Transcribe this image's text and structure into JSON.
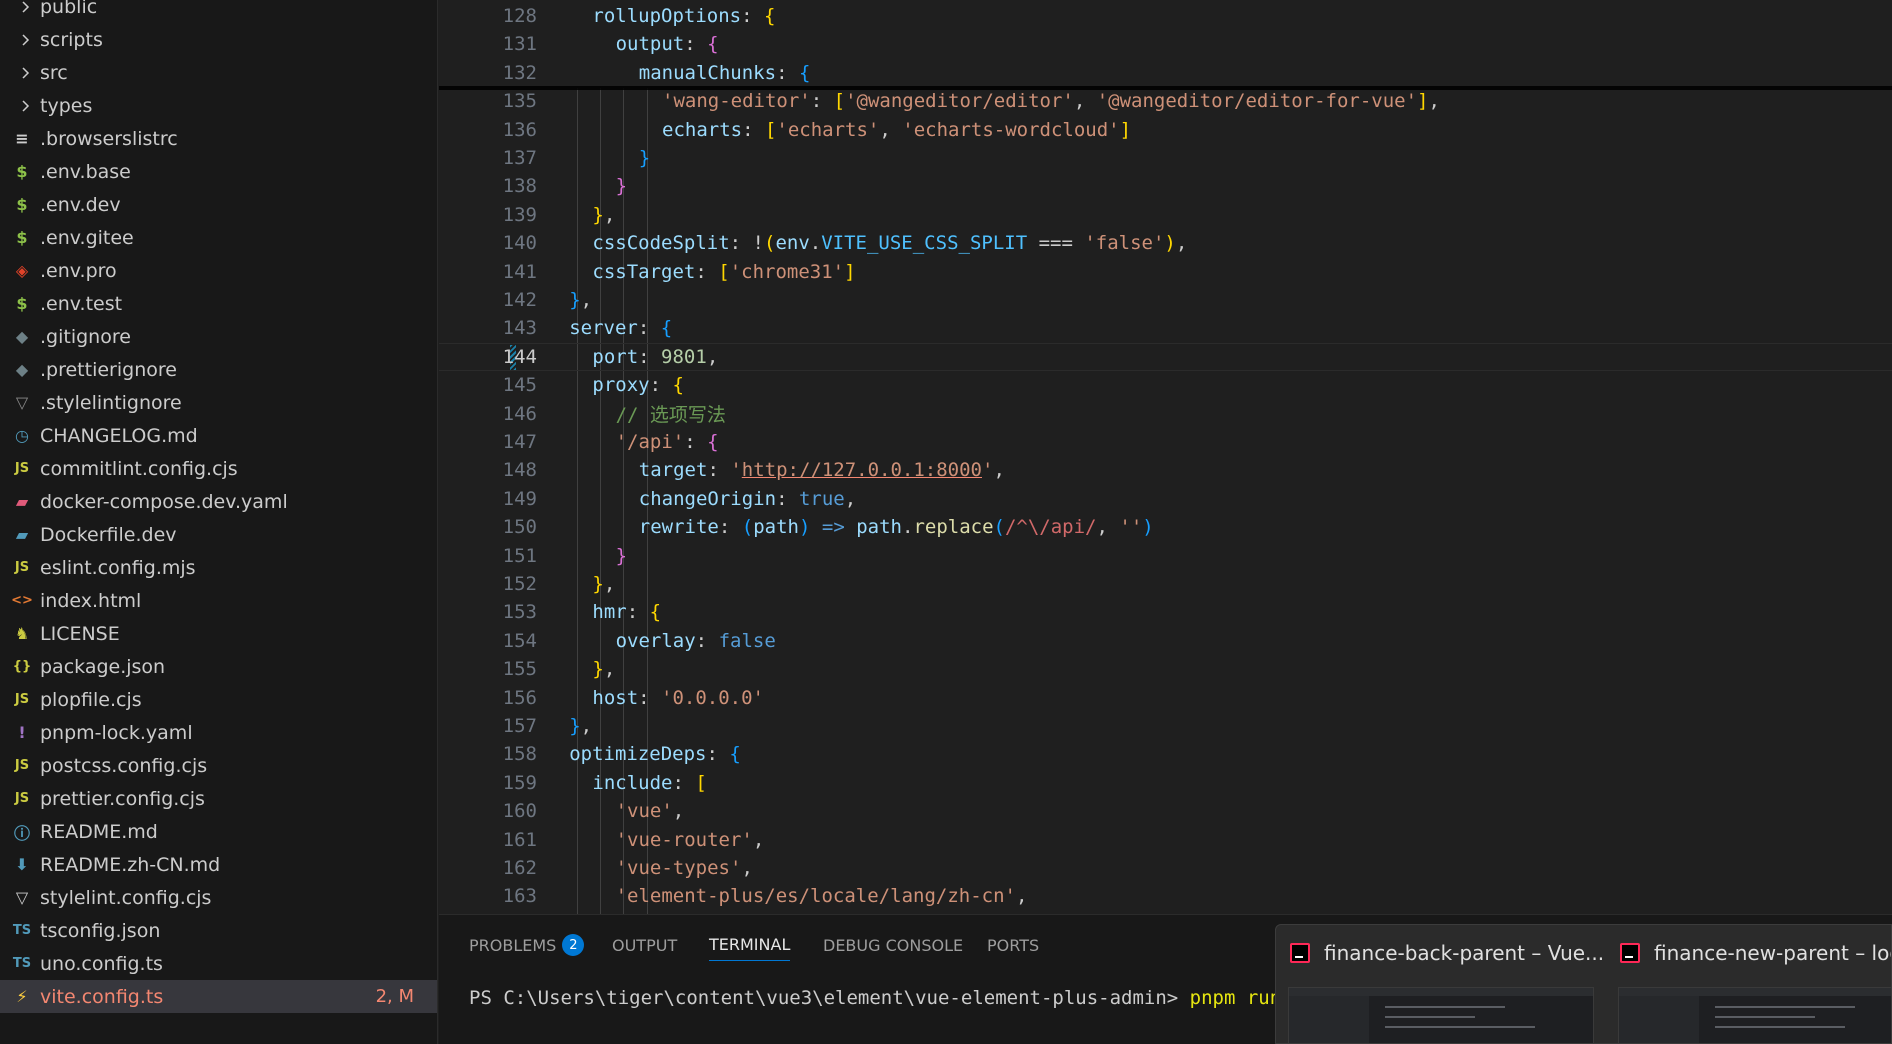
{
  "explorer": {
    "items": [
      {
        "label": "public",
        "icon": "chevron-right-icon",
        "kind": "folder"
      },
      {
        "label": "scripts",
        "icon": "chevron-right-icon",
        "kind": "folder"
      },
      {
        "label": "src",
        "icon": "chevron-right-icon",
        "kind": "folder"
      },
      {
        "label": "types",
        "icon": "chevron-right-icon",
        "kind": "folder"
      },
      {
        "label": ".browserslistrc",
        "icon": "lines-icon",
        "glyph": "≡",
        "color": "#cccccc"
      },
      {
        "label": ".env.base",
        "icon": "dollar-icon",
        "glyph": "$",
        "color": "#8dc149"
      },
      {
        "label": ".env.dev",
        "icon": "dollar-icon",
        "glyph": "$",
        "color": "#8dc149"
      },
      {
        "label": ".env.gitee",
        "icon": "dollar-icon",
        "glyph": "$",
        "color": "#8dc149"
      },
      {
        "label": ".env.pro",
        "icon": "gitlab-fox-icon",
        "glyph": "◈",
        "color": "#e24329"
      },
      {
        "label": ".env.test",
        "icon": "dollar-icon",
        "glyph": "$",
        "color": "#8dc149"
      },
      {
        "label": ".gitignore",
        "icon": "git-diamond-icon",
        "glyph": "◆",
        "color": "#6d8086"
      },
      {
        "label": ".prettierignore",
        "icon": "git-diamond-icon",
        "glyph": "◆",
        "color": "#6d8086"
      },
      {
        "label": ".stylelintignore",
        "icon": "stylelint-icon",
        "glyph": "▽",
        "color": "#8a8a8a"
      },
      {
        "label": "CHANGELOG.md",
        "icon": "clock-icon",
        "glyph": "◷",
        "color": "#519aba"
      },
      {
        "label": "commitlint.config.cjs",
        "icon": "javascript-icon",
        "glyph": "JS",
        "color": "#cbcb41"
      },
      {
        "label": "docker-compose.dev.yaml",
        "icon": "docker-icon",
        "glyph": "▰",
        "color": "#e05a7a"
      },
      {
        "label": "Dockerfile.dev",
        "icon": "docker-icon",
        "glyph": "▰",
        "color": "#519aba"
      },
      {
        "label": "eslint.config.mjs",
        "icon": "javascript-icon",
        "glyph": "JS",
        "color": "#cbcb41"
      },
      {
        "label": "index.html",
        "icon": "html-icon",
        "glyph": "<>",
        "color": "#e37933"
      },
      {
        "label": "LICENSE",
        "icon": "license-icon",
        "glyph": "♞",
        "color": "#cbcb41"
      },
      {
        "label": "package.json",
        "icon": "json-braces-icon",
        "glyph": "{}",
        "color": "#cbcb41"
      },
      {
        "label": "plopfile.cjs",
        "icon": "javascript-icon",
        "glyph": "JS",
        "color": "#cbcb41"
      },
      {
        "label": "pnpm-lock.yaml",
        "icon": "exclamation-icon",
        "glyph": "!",
        "color": "#a074c4"
      },
      {
        "label": "postcss.config.cjs",
        "icon": "javascript-icon",
        "glyph": "JS",
        "color": "#cbcb41"
      },
      {
        "label": "prettier.config.cjs",
        "icon": "javascript-icon",
        "glyph": "JS",
        "color": "#cbcb41"
      },
      {
        "label": "README.md",
        "icon": "info-icon",
        "glyph": "ⓘ",
        "color": "#519aba"
      },
      {
        "label": "README.zh-CN.md",
        "icon": "download-arrow-icon",
        "glyph": "⬇",
        "color": "#519aba"
      },
      {
        "label": "stylelint.config.cjs",
        "icon": "stylelint-icon",
        "glyph": "▽",
        "color": "#cccccc"
      },
      {
        "label": "tsconfig.json",
        "icon": "typescript-icon",
        "glyph": "TS",
        "color": "#519aba"
      },
      {
        "label": "uno.config.ts",
        "icon": "typescript-icon",
        "glyph": "TS",
        "color": "#519aba"
      },
      {
        "label": "vite.config.ts",
        "icon": "vite-bolt-icon",
        "glyph": "⚡",
        "color": "#ffcf40",
        "badge": "2, M",
        "selected": true
      }
    ]
  },
  "editor": {
    "active_line": "144",
    "lines": [
      {
        "n": "128",
        "indent": 1,
        "tokens": [
          [
            "k",
            "rollupOptions"
          ],
          [
            "p",
            ": "
          ],
          [
            "br1",
            "{"
          ]
        ]
      },
      {
        "n": "131",
        "indent": 2,
        "tokens": [
          [
            "k",
            "output"
          ],
          [
            "p",
            ": "
          ],
          [
            "br2",
            "{"
          ]
        ]
      },
      {
        "n": "132",
        "indent": 3,
        "tokens": [
          [
            "k",
            "manualChunks"
          ],
          [
            "p",
            ": "
          ],
          [
            "br3",
            "{"
          ]
        ]
      },
      {
        "n": "135",
        "indent": 4,
        "tokens": [
          [
            "s",
            "'wang-editor'"
          ],
          [
            "p",
            ": "
          ],
          [
            "br1",
            "["
          ],
          [
            "s",
            "'@wangeditor/editor'"
          ],
          [
            "p",
            ", "
          ],
          [
            "s",
            "'@wangeditor/editor-for-vue'"
          ],
          [
            "br1",
            "]"
          ],
          [
            "p",
            ","
          ]
        ]
      },
      {
        "n": "136",
        "indent": 4,
        "tokens": [
          [
            "k",
            "echarts"
          ],
          [
            "p",
            ": "
          ],
          [
            "br1",
            "["
          ],
          [
            "s",
            "'echarts'"
          ],
          [
            "p",
            ", "
          ],
          [
            "s",
            "'echarts-wordcloud'"
          ],
          [
            "br1",
            "]"
          ]
        ]
      },
      {
        "n": "137",
        "indent": 3,
        "tokens": [
          [
            "br3",
            "}"
          ]
        ]
      },
      {
        "n": "138",
        "indent": 2,
        "tokens": [
          [
            "br2",
            "}"
          ]
        ]
      },
      {
        "n": "139",
        "indent": 1,
        "tokens": [
          [
            "br1",
            "}"
          ],
          [
            "p",
            ","
          ]
        ]
      },
      {
        "n": "140",
        "indent": 1,
        "tokens": [
          [
            "k",
            "cssCodeSplit"
          ],
          [
            "p",
            ": !"
          ],
          [
            "br1",
            "("
          ],
          [
            "k",
            "env"
          ],
          [
            "p",
            "."
          ],
          [
            "cn",
            "VITE_USE_CSS_SPLIT"
          ],
          [
            "p",
            " === "
          ],
          [
            "s",
            "'false'"
          ],
          [
            "br1",
            ")"
          ],
          [
            "p",
            ","
          ]
        ]
      },
      {
        "n": "141",
        "indent": 1,
        "tokens": [
          [
            "k",
            "cssTarget"
          ],
          [
            "p",
            ": "
          ],
          [
            "br1",
            "["
          ],
          [
            "s",
            "'chrome31'"
          ],
          [
            "br1",
            "]"
          ]
        ]
      },
      {
        "n": "142",
        "indent": 0,
        "tokens": [
          [
            "br3",
            "}"
          ],
          [
            "p",
            ","
          ]
        ]
      },
      {
        "n": "143",
        "indent": 0,
        "tokens": [
          [
            "k",
            "server"
          ],
          [
            "p",
            ": "
          ],
          [
            "br3",
            "{"
          ]
        ]
      },
      {
        "n": "144",
        "indent": 1,
        "tokens": [
          [
            "k",
            "port"
          ],
          [
            "p",
            ": "
          ],
          [
            "n",
            "9801"
          ],
          [
            "p",
            ","
          ]
        ]
      },
      {
        "n": "145",
        "indent": 1,
        "tokens": [
          [
            "k",
            "proxy"
          ],
          [
            "p",
            ": "
          ],
          [
            "br1",
            "{"
          ]
        ]
      },
      {
        "n": "146",
        "indent": 2,
        "tokens": [
          [
            "c",
            "// 选项写法"
          ]
        ]
      },
      {
        "n": "147",
        "indent": 2,
        "tokens": [
          [
            "s",
            "'/api'"
          ],
          [
            "p",
            ": "
          ],
          [
            "br2",
            "{"
          ]
        ]
      },
      {
        "n": "148",
        "indent": 3,
        "tokens": [
          [
            "k",
            "target"
          ],
          [
            "p",
            ": "
          ],
          [
            "s",
            "'"
          ],
          [
            "su",
            "http://127.0.0.1:8000"
          ],
          [
            "s",
            "'"
          ],
          [
            "p",
            ","
          ]
        ]
      },
      {
        "n": "149",
        "indent": 3,
        "tokens": [
          [
            "k",
            "changeOrigin"
          ],
          [
            "p",
            ": "
          ],
          [
            "b",
            "true"
          ],
          [
            "p",
            ","
          ]
        ]
      },
      {
        "n": "150",
        "indent": 3,
        "tokens": [
          [
            "k",
            "rewrite"
          ],
          [
            "p",
            ": "
          ],
          [
            "br3",
            "("
          ],
          [
            "k",
            "path"
          ],
          [
            "br3",
            ")"
          ],
          [
            "p",
            " "
          ],
          [
            "b",
            "=>"
          ],
          [
            "p",
            " "
          ],
          [
            "k",
            "path"
          ],
          [
            "p",
            "."
          ],
          [
            "f",
            "replace"
          ],
          [
            "br3",
            "("
          ],
          [
            "rx",
            "/^\\/api/"
          ],
          [
            "p",
            ", "
          ],
          [
            "s",
            "''"
          ],
          [
            "br3",
            ")"
          ]
        ]
      },
      {
        "n": "151",
        "indent": 2,
        "tokens": [
          [
            "br2",
            "}"
          ]
        ]
      },
      {
        "n": "152",
        "indent": 1,
        "tokens": [
          [
            "br1",
            "}"
          ],
          [
            "p",
            ","
          ]
        ]
      },
      {
        "n": "153",
        "indent": 1,
        "tokens": [
          [
            "k",
            "hmr"
          ],
          [
            "p",
            ": "
          ],
          [
            "br1",
            "{"
          ]
        ]
      },
      {
        "n": "154",
        "indent": 2,
        "tokens": [
          [
            "k",
            "overlay"
          ],
          [
            "p",
            ": "
          ],
          [
            "b",
            "false"
          ]
        ]
      },
      {
        "n": "155",
        "indent": 1,
        "tokens": [
          [
            "br1",
            "}"
          ],
          [
            "p",
            ","
          ]
        ]
      },
      {
        "n": "156",
        "indent": 1,
        "tokens": [
          [
            "k",
            "host"
          ],
          [
            "p",
            ": "
          ],
          [
            "s",
            "'0.0.0.0'"
          ]
        ]
      },
      {
        "n": "157",
        "indent": 0,
        "tokens": [
          [
            "br3",
            "}"
          ],
          [
            "p",
            ","
          ]
        ]
      },
      {
        "n": "158",
        "indent": 0,
        "tokens": [
          [
            "k",
            "optimizeDeps"
          ],
          [
            "p",
            ": "
          ],
          [
            "br3",
            "{"
          ]
        ]
      },
      {
        "n": "159",
        "indent": 1,
        "tokens": [
          [
            "k",
            "include"
          ],
          [
            "p",
            ": "
          ],
          [
            "br1",
            "["
          ]
        ]
      },
      {
        "n": "160",
        "indent": 2,
        "tokens": [
          [
            "s",
            "'vue'"
          ],
          [
            "p",
            ","
          ]
        ]
      },
      {
        "n": "161",
        "indent": 2,
        "tokens": [
          [
            "s",
            "'vue-router'"
          ],
          [
            "p",
            ","
          ]
        ]
      },
      {
        "n": "162",
        "indent": 2,
        "tokens": [
          [
            "s",
            "'vue-types'"
          ],
          [
            "p",
            ","
          ]
        ]
      },
      {
        "n": "163",
        "indent": 2,
        "tokens": [
          [
            "s",
            "'element-plus/es/locale/lang/zh-cn'"
          ],
          [
            "p",
            ","
          ]
        ]
      }
    ]
  },
  "panel": {
    "tabs": [
      {
        "label": "PROBLEMS",
        "badge": "2"
      },
      {
        "label": "OUTPUT"
      },
      {
        "label": "TERMINAL",
        "active": true
      },
      {
        "label": "DEBUG CONSOLE"
      },
      {
        "label": "PORTS"
      }
    ],
    "terminal_prompt": "PS C:\\Users\\tiger\\content\\vue3\\element\\vue-element-plus-admin> ",
    "terminal_command": "pnpm run d"
  },
  "taskbar_preview": {
    "windows": [
      {
        "title": "finance-back-parent – Vue..."
      },
      {
        "title": "finance-new-parent – logb"
      }
    ]
  }
}
